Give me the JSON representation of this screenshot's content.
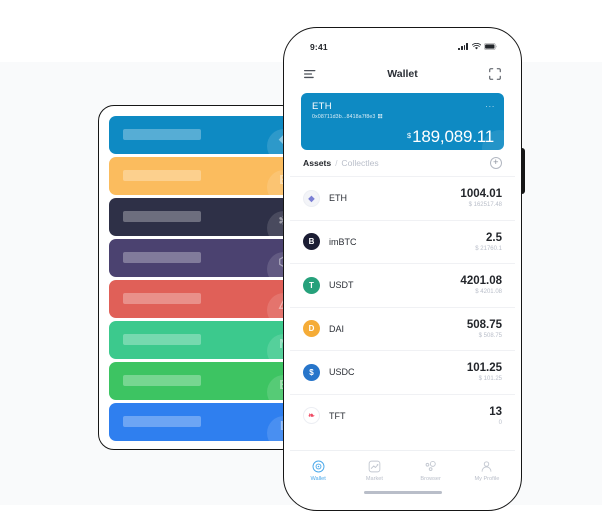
{
  "phone": {
    "statusbar": {
      "time": "9:41",
      "signal_icon": "cellular-signal-icon",
      "wifi_icon": "wifi-icon",
      "battery_icon": "battery-icon"
    },
    "navbar": {
      "menu_icon": "hamburger-menu-icon",
      "title": "Wallet",
      "scan_icon": "scan-qr-icon"
    },
    "balance_card": {
      "wallet_name": "ETH",
      "address": "0x08711d3b...8418a7f8e3",
      "copy_icon": "copy-address-icon",
      "more_icon": "more-options-icon",
      "currency_symbol": "$",
      "amount": "189,089.11",
      "bg_color": "#0e8ac3"
    },
    "tabs": {
      "assets_label": "Assets",
      "separator": "/",
      "collectibles_label": "Collectles",
      "add_icon": "add-asset-icon",
      "add_label": "+"
    },
    "assets": [
      {
        "name": "ETH",
        "amount": "1004.01",
        "fiat": "$ 162517.48",
        "icon": "eth-coin-icon",
        "color": "#f3f4f8",
        "text_color": "#7b7fd4",
        "glyph": "◆"
      },
      {
        "name": "imBTC",
        "amount": "2.5",
        "fiat": "$ 21760.1",
        "icon": "imbtc-coin-icon",
        "color": "#1b1d33",
        "text_color": "#ffffff",
        "glyph": "B"
      },
      {
        "name": "USDT",
        "amount": "4201.08",
        "fiat": "$ 4201.08",
        "icon": "usdt-coin-icon",
        "color": "#26a17b",
        "text_color": "#ffffff",
        "glyph": "T"
      },
      {
        "name": "DAI",
        "amount": "508.75",
        "fiat": "$ 508.75",
        "icon": "dai-coin-icon",
        "color": "#f5ac37",
        "text_color": "#ffffff",
        "glyph": "D"
      },
      {
        "name": "USDC",
        "amount": "101.25",
        "fiat": "$ 101.25",
        "icon": "usdc-coin-icon",
        "color": "#2775ca",
        "text_color": "#ffffff",
        "glyph": "$"
      },
      {
        "name": "TFT",
        "amount": "13",
        "fiat": "0",
        "icon": "tft-coin-icon",
        "color": "#ffffff",
        "text_color": "#ef4a63",
        "glyph": "❧"
      }
    ],
    "bottom_nav": [
      {
        "label": "Wallet",
        "icon": "wallet-tab-icon",
        "active": true
      },
      {
        "label": "Market",
        "icon": "market-tab-icon",
        "active": false
      },
      {
        "label": "Browser",
        "icon": "browser-tab-icon",
        "active": false
      },
      {
        "label": "My Profile",
        "icon": "profile-tab-icon",
        "active": false
      }
    ]
  },
  "card_stack": {
    "cards": [
      {
        "color": "#0e8ac3",
        "mark": "◆",
        "name": "eth-card"
      },
      {
        "color": "#fbbc5e",
        "mark": "B",
        "name": "btc-card"
      },
      {
        "color": "#2e3047",
        "mark": "✻",
        "name": "dark-card"
      },
      {
        "color": "#4b4270",
        "mark": "⬡",
        "name": "eos-card"
      },
      {
        "color": "#e06058",
        "mark": "△",
        "name": "red-card"
      },
      {
        "color": "#3cc98d",
        "mark": "N",
        "name": "neo-card"
      },
      {
        "color": "#3dc462",
        "mark": "B",
        "name": "bch-card"
      },
      {
        "color": "#2f7fef",
        "mark": "L",
        "name": "ltc-card"
      }
    ]
  },
  "colors": {
    "accent": "#0e8ac3",
    "tab_active": "#4aa8ea",
    "background": "#f9fafb",
    "text_primary": "#23262b",
    "text_muted": "#b9bec9"
  }
}
